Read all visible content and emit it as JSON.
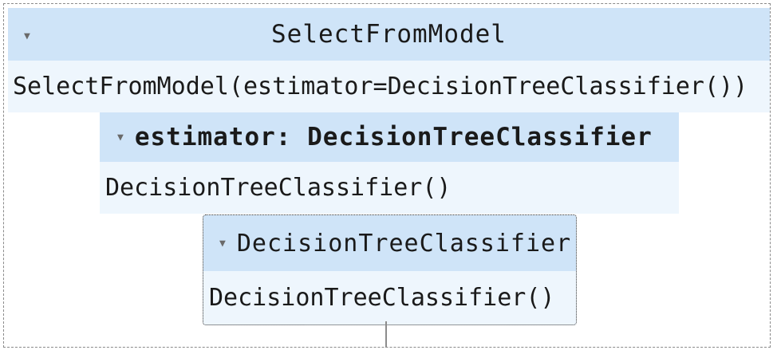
{
  "selector": {
    "title": "SelectFromModel",
    "repr": "SelectFromModel(estimator=DecisionTreeClassifier())",
    "expand_icon": "triangle-down-icon"
  },
  "estimator_param": {
    "title": "estimator: DecisionTreeClassifier",
    "repr": "DecisionTreeClassifier()",
    "expand_icon": "triangle-down-icon"
  },
  "estimator": {
    "title": "DecisionTreeClassifier",
    "repr": "DecisionTreeClassifier()",
    "expand_icon": "triangle-down-icon"
  },
  "colors": {
    "header_bg": "#cfe4f8",
    "body_bg": "#eef6fd",
    "border": "#8a8a8a"
  }
}
